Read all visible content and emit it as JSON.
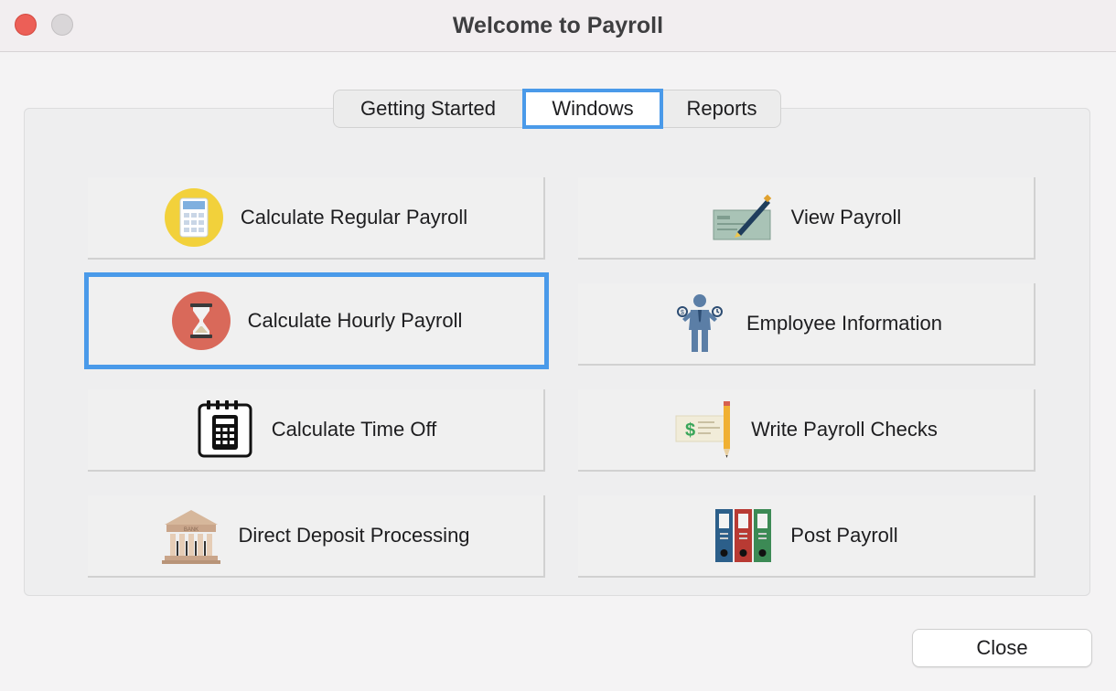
{
  "window": {
    "title": "Welcome to Payroll",
    "controls": [
      "close",
      "minimize"
    ]
  },
  "tabs": [
    {
      "label": "Getting Started",
      "selected": false
    },
    {
      "label": "Windows",
      "selected": true
    },
    {
      "label": "Reports",
      "selected": false
    }
  ],
  "tiles": {
    "left": [
      {
        "label": "Calculate Regular Payroll",
        "icon": "calculator-icon",
        "selected": false
      },
      {
        "label": "Calculate Hourly Payroll",
        "icon": "hourglass-icon",
        "selected": true
      },
      {
        "label": "Calculate Time Off",
        "icon": "calendar-calculator-icon",
        "selected": false
      },
      {
        "label": "Direct Deposit Processing",
        "icon": "bank-icon",
        "selected": false
      }
    ],
    "right": [
      {
        "label": "View Payroll",
        "icon": "check-pen-icon",
        "selected": false
      },
      {
        "label": "Employee Information",
        "icon": "employee-icon",
        "selected": false
      },
      {
        "label": "Write Payroll Checks",
        "icon": "check-pencil-icon",
        "selected": false
      },
      {
        "label": "Post Payroll",
        "icon": "binders-icon",
        "selected": false
      }
    ]
  },
  "buttons": {
    "close_label": "Close"
  },
  "colors": {
    "accent": "#4a9ae9",
    "close_light": "#ec5f57"
  }
}
